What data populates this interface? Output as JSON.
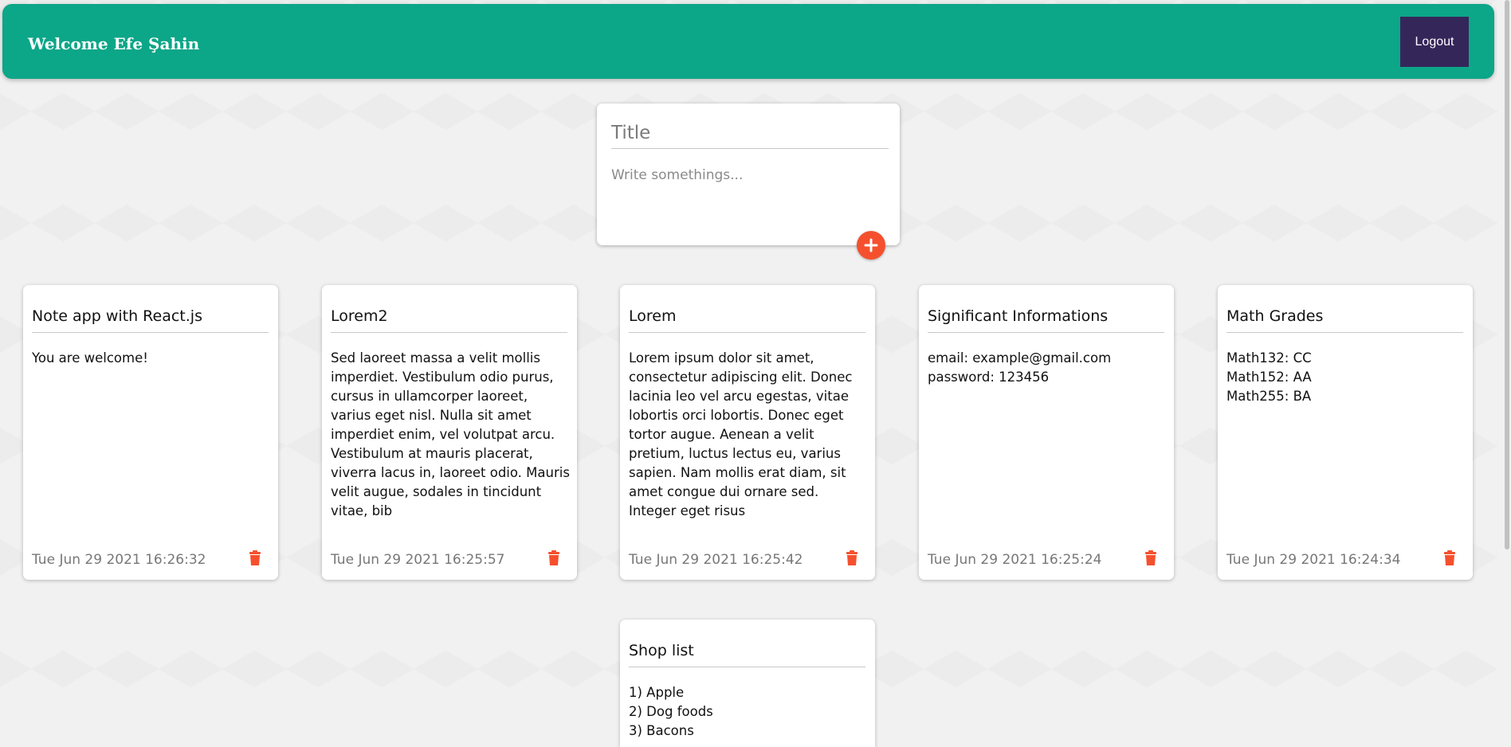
{
  "header": {
    "welcome_text": "Welcome Efe Şahin",
    "logout_label": "Logout"
  },
  "composer": {
    "title_placeholder": "Title",
    "body_placeholder": "Write somethings...",
    "add_icon": "plus-icon"
  },
  "notes": [
    {
      "title": "Note app with React.js",
      "body": "You are welcome!",
      "date": "Tue Jun 29 2021 16:26:32"
    },
    {
      "title": "Lorem2",
      "body": "Sed laoreet massa a velit mollis imperdiet. Vestibulum odio purus, cursus in ullamcorper laoreet, varius eget nisl. Nulla sit amet imperdiet enim, vel volutpat arcu. Vestibulum at mauris placerat, viverra lacus in, laoreet odio. Mauris velit augue, sodales in tincidunt vitae, bib",
      "date": "Tue Jun 29 2021 16:25:57"
    },
    {
      "title": "Lorem",
      "body": "Lorem ipsum dolor sit amet, consectetur adipiscing elit. Donec lacinia leo vel arcu egestas, vitae lobortis orci lobortis. Donec eget tortor augue. Aenean a velit pretium, luctus lectus eu, varius sapien. Nam mollis erat diam, sit amet congue dui ornare sed. Integer eget risus",
      "date": "Tue Jun 29 2021 16:25:42"
    },
    {
      "title": "Significant Informations",
      "body": "email: example@gmail.com\npassword: 123456",
      "date": "Tue Jun 29 2021 16:25:24"
    },
    {
      "title": "Math Grades",
      "body": "Math132: CC\nMath152: AA\nMath255: BA",
      "date": "Tue Jun 29 2021 16:24:34"
    },
    {
      "title": "Shop list",
      "body": "1) Apple\n2) Dog foods\n3) Bacons",
      "date": ""
    }
  ],
  "colors": {
    "header_bg": "#0ca688",
    "logout_bg": "#35265a",
    "accent": "#f5502e"
  }
}
